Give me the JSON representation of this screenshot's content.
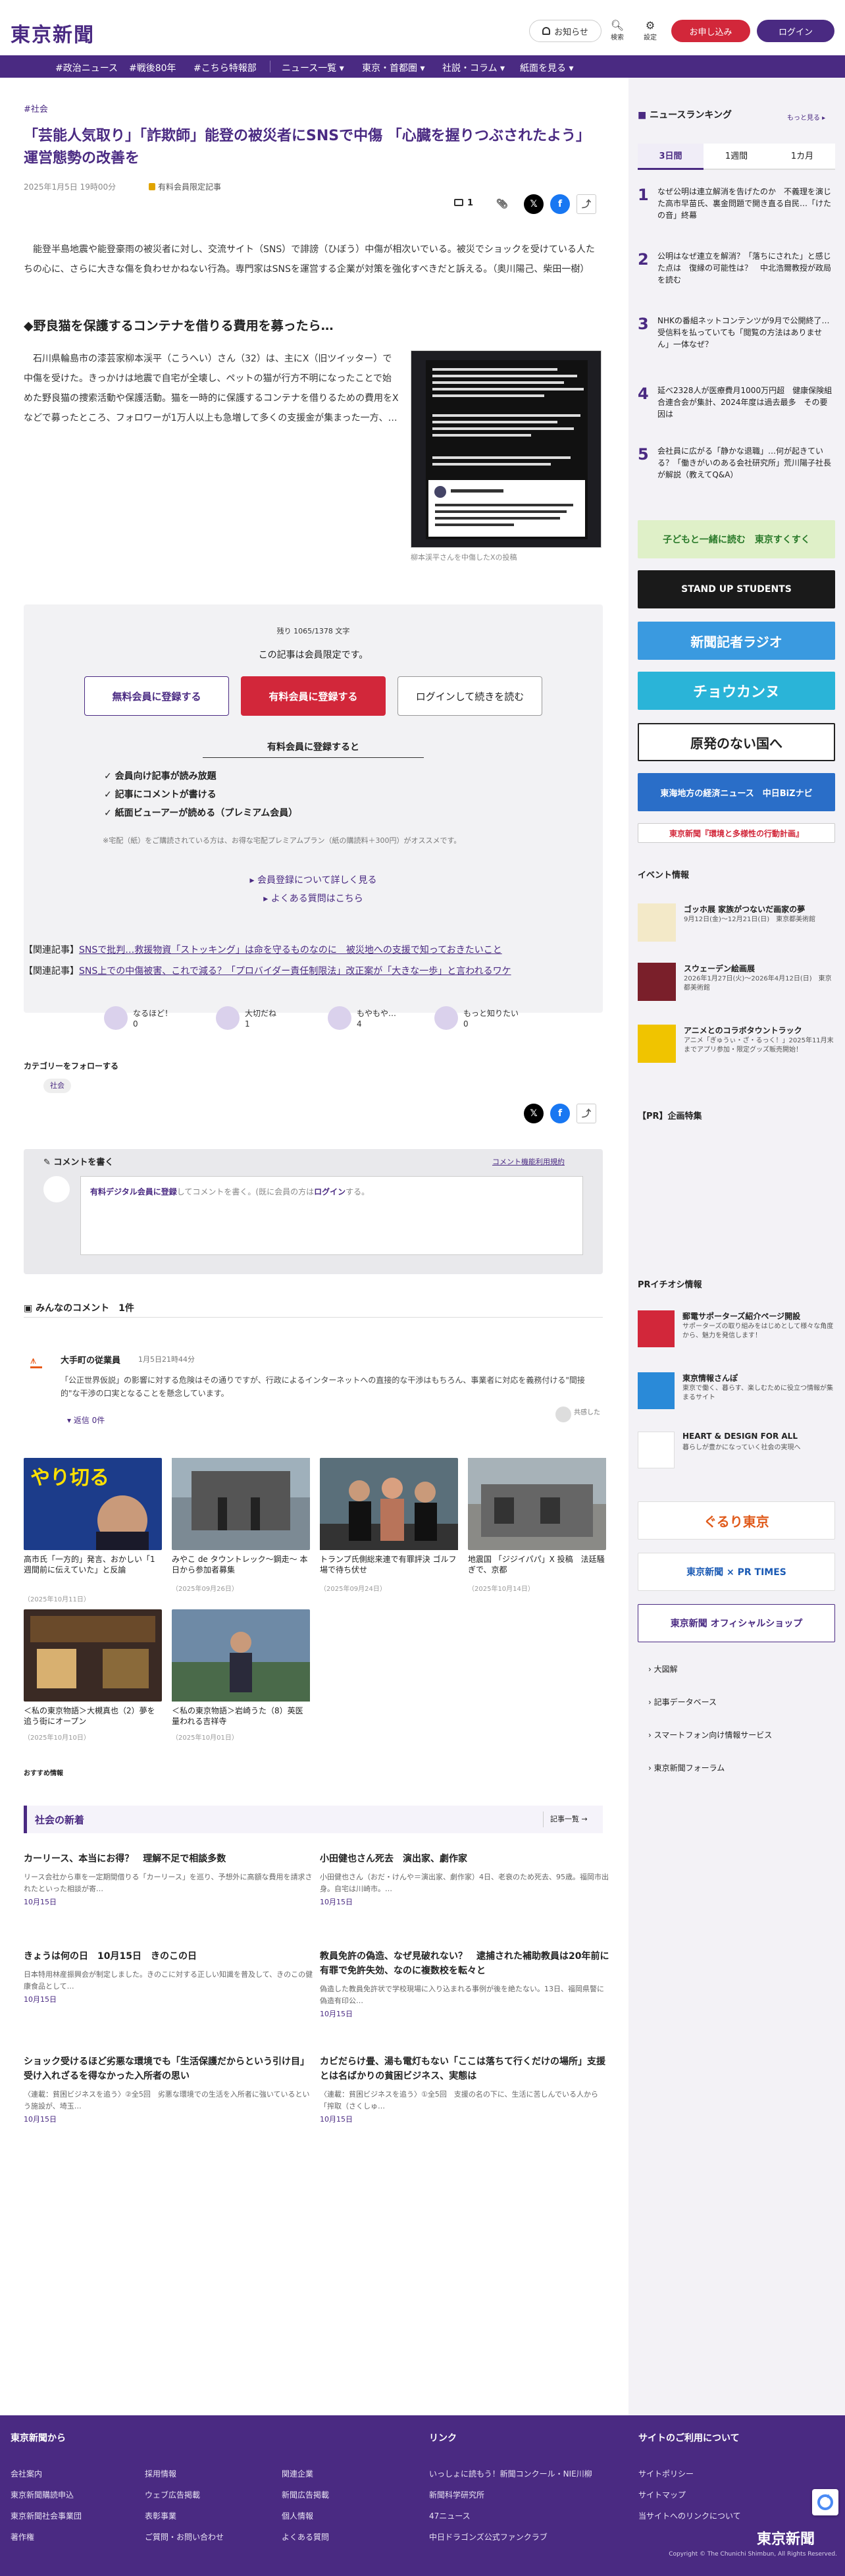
{
  "header": {
    "logo": "東京新聞",
    "notify": "お知らせ",
    "search": "検索",
    "settings": "設定",
    "register": "お申し込み",
    "login": "ログイン"
  },
  "nav": {
    "items": [
      "#政治ニュース",
      "#戦後80年",
      "#こちら特報部",
      "ニュース一覧 ▾",
      "東京・首都圏 ▾",
      "社説・コラム ▾",
      "紙面を見る ▾"
    ]
  },
  "article": {
    "crumb": "#社会",
    "title": "「芸能人気取り」「詐欺師」能登の被災者にSNSで中傷 「心臓を握りつぶされたよう」運営態勢の改善を",
    "date": "2025年1月5日 19時00分",
    "members": "有料会員限定記事",
    "comment_count": "1",
    "lead": "能登半島地震や能登豪雨の被災者に対し、交流サイト（SNS）で誹謗（ひぼう）中傷が相次いでいる。被災でショックを受けている人たちの心に、さらに大きな傷を負わせかねない行為。専門家はSNSを運営する企業が対策を強化すべきだと訴える。（奥川陽己、柴田一樹）",
    "subhead": "◆野良猫を保護するコンテナを借りる費用を募ったら…",
    "body": "石川県輪島市の漆芸家柳本渓平（こうへい）さん（32）は、主にX（旧ツイッター）で中傷を受けた。きっかけは地震で自宅が全壊し、ペットの猫が行方不明になったことで始めた野良猫の捜索活動や保護活動。猫を一時的に保護するコンテナを借りるための費用をXなどで募ったところ、フォロワーが1万人以上も急増して多くの支援金が集まった一方、…",
    "caption": "柳本渓平さんを中傷したXの投稿"
  },
  "paywall": {
    "remaining": "残り 1065/1378 文字",
    "limited": "この記事は会員限定です。",
    "free_btn": "無料会員に登録する",
    "paid_btn": "有料会員に登録する",
    "login_btn": "ログインして続きを読む",
    "features_title": "有料会員に登録すると",
    "features": [
      "✓ 会員向け記事が読み放題",
      "✓ 記事にコメントが書ける",
      "✓ 紙面ビューアーが読める（プレミアム会員）"
    ],
    "note": "※宅配（紙）をご購読されている方は、お得な宅配プレミアムプラン（紙の購読料＋300円）がオススメです。",
    "more": "▸ 会員登録について詳しく見る",
    "faq": "▸ よくある質問はこちら"
  },
  "related": [
    {
      "tag": "【関連記事】",
      "text": "SNSで批判…救援物資「ストッキング」は命を守るものなのに　被災地への支援で知っておきたいこと"
    },
    {
      "tag": "【関連記事】",
      "text": "SNS上での中傷被害、これで減る？「プロバイダー責任制限法」改正案が「大きな一歩」と言われるワケ"
    }
  ],
  "reactions": [
    {
      "label": "なるほど！",
      "count": "0"
    },
    {
      "label": "大切だね",
      "count": "1"
    },
    {
      "label": "もやもや…",
      "count": "4"
    },
    {
      "label": "もっと知りたい",
      "count": "0"
    }
  ],
  "follow": {
    "title": "カテゴリーをフォローする",
    "tag": "社会"
  },
  "comment_form": {
    "title": "コメントを書く",
    "policy": "コメント機能利用規約",
    "link": "有料デジタル会員に登録",
    "text": "してコメントを書く。(既に会員の方は",
    "login": "ログイン",
    "tail": "する。"
  },
  "comments": {
    "title": "みんなのコメント",
    "count": "1件",
    "user": "大手町の従業員",
    "date": "1月5日21時44分",
    "text": "「公正世界仮説」の影響に対する危険はその通りですが、行政によるインターネットへの直接的な干渉はもちろん、事業者に対応を義務付ける\"間接的\"な干渉の口実となることを懸念しています。",
    "replies": "返信 0件",
    "like": "共感した"
  },
  "cards": [
    {
      "title": "高市氏「一方的」発言、おかしい「1週間前に伝えていた」と反論",
      "date": "（2025年10月11日）"
    },
    {
      "title": "みやこ de タウントレック〜鋼走〜 本日から参加者募集",
      "date": "（2025年09月26日）"
    },
    {
      "title": "トランプ氏側総来連で有罪評決 ゴルフ場で待ち伏せ",
      "date": "（2025年09月24日）"
    },
    {
      "title": "地震国 「ジジイパパ」X 投稿　法廷騒ぎで、京都",
      "date": "（2025年10月14日）"
    },
    {
      "title": "＜私の東京物語＞大槻真也（2）夢を追う街にオープン",
      "date": "（2025年10月10日）"
    },
    {
      "title": "＜私の東京物語＞岩崎うた（8）英医量われる吉祥寺",
      "date": "（2025年10月01日）"
    }
  ],
  "osusume": "おすすめ情報",
  "news": {
    "title": "社会の新着",
    "more": "記事一覧",
    "items": [
      {
        "title": "カーリース、本当にお得？　理解不足で相談多数",
        "body": "リース会社から車を一定期間借りる「カーリース」を巡り、予想外に高額な費用を請求されたといった相談が寄…",
        "date": "10月15日"
      },
      {
        "title": "小田健也さん死去　演出家、劇作家",
        "body": "小田健也さん（おだ・けんや＝演出家、劇作家）4日、老衰のため死去、95歳。福岡市出身。自宅は川崎市。…",
        "date": "10月15日"
      },
      {
        "title": "きょうは何の日　10月15日　きのこの日",
        "body": "日本特用林産振興会が制定しました。きのこに対する正しい知識を普及して、きのこの健康食品として…",
        "date": "10月15日"
      },
      {
        "title": "教員免許の偽造、なぜ見破れない？　逮捕された補助教員は20年前に有罪で免許失効、なのに複数校を転々と",
        "body": "偽造した教員免許状で学校現場に入り込まれる事例が後を絶たない。13日、福岡県警に偽造有印公…",
        "date": "10月15日"
      },
      {
        "title": "ショック受けるほど劣悪な環境でも「生活保護だからという引け目」受け入れざるを得なかった入所者の思い",
        "body": "〈連載：貧困ビジネスを追う〉②全5回　劣悪な環境での生活を入所者に強いているという施設が、埼玉…",
        "date": "10月15日"
      },
      {
        "title": "カビだらけ畳、湯も電灯もない「ここは落ちて行くだけの場所」支援とは名ばかりの貧困ビジネス、実態は",
        "body": "〈連載：貧困ビジネスを追う〉①全5回　支援の名の下に、生活に苦しんでいる人から「搾取（さくしゅ…",
        "date": "10月15日"
      }
    ]
  },
  "sidebar": {
    "ranking_title": "ニュースランキング",
    "ranking_more": "もっと見る ▸",
    "tabs": [
      "3日間",
      "1週間",
      "1カ月"
    ],
    "ranking": [
      {
        "n": "1",
        "t": "なぜ公明は連立解消を告げたのか　不義理を演じた高市早苗氏、裏金問題で開き直る自民…「けたの音」終幕"
      },
      {
        "n": "2",
        "t": "公明はなぜ連立を解消？「落ちにされた」と感じた点は　復縁の可能性は？　中北浩爾教授が政局を読む"
      },
      {
        "n": "3",
        "t": "NHKの番組ネットコンテンツが9月で公開終了…受信料を払っていても「閲覧の方法はありません」一体なぜ？"
      },
      {
        "n": "4",
        "t": "延べ2328人が医療費月1000万円超　健康保険組合連合会が集計、2024年度は過去最多　その要因は"
      },
      {
        "n": "5",
        "t": "会社員に広がる「静かな退職」…何が起きている？「働きがいのある会社研究所」荒川陽子社長が解説（教えてQ&A）"
      }
    ],
    "banners": [
      "子どもと一緒に読む　東京すくすく",
      "STAND UP STUDENTS",
      "新聞記者ラジオ",
      "チョウカンヌ",
      "原発のない国へ",
      "東海地方の経済ニュース　中日BiZナビ",
      "東京新聞『環境と多様性の行動計画』"
    ],
    "events_title": "イベント情報",
    "events": [
      {
        "t": "ゴッホ展 家族がつないだ画家の夢",
        "d": "9月12日(金)〜12月21日(日)　東京都美術館"
      },
      {
        "t": "スウェーデン絵画展",
        "d": "2026年1月27日(火)〜2026年4月12日(日)　東京都美術館"
      },
      {
        "t": "アニメとのコラボタウントラック",
        "d": "アニメ「ぎゅうぃ・ざ・るっく！」2025年11月末までアプリ参加・限定グッズ販売開始！"
      }
    ],
    "pr_title": "【PR】企画特集",
    "pr2_title": "PRイチオシ情報",
    "pr": [
      {
        "t": "郵電サポーターズ紹介ページ開設",
        "d": "サポーターズの取り組みをはじめとして様々な角度から、魅力を発信します！"
      },
      {
        "t": "東京情報さんぽ",
        "d": "東京で働く、暮らす、楽しむために役立つ情報が集まるサイト"
      },
      {
        "t": "HEART & DESIGN FOR ALL",
        "d": "暮らしが豊かになっていく社会の実現へ"
      }
    ],
    "banners2": [
      "ぐるり東京",
      "東京新聞 × PR TIMES",
      "東京新聞 オフィシャルショップ"
    ],
    "links": [
      "大図解",
      "記事データベース",
      "スマートフォン向け情報サービス",
      "東京新聞フォーラム"
    ]
  },
  "footer": {
    "col1_title": "東京新聞から",
    "col1": [
      "会社案内",
      "採用情報",
      "関連企業",
      "東京新聞購読申込",
      "ウェブ広告掲載",
      "新聞広告掲載",
      "東京新聞社会事業団",
      "表彰事業",
      "個人情報",
      "著作権",
      "ご質問・お問い合わせ",
      "よくある質問"
    ],
    "col2_title": "リンク",
    "col2": [
      "いっしょに読もう！新聞コンクール・NIE川柳",
      "新聞科学研究所",
      "47ニュース",
      "中日ドラゴンズ公式ファンクラブ"
    ],
    "col3_title": "サイトのご利用について",
    "col3": [
      "サイトポリシー",
      "サイトマップ",
      "当サイトへのリンクについて"
    ],
    "logo": "東京新聞",
    "copyright": "Copyright © The Chunichi Shimbun, All Rights Reserved."
  }
}
